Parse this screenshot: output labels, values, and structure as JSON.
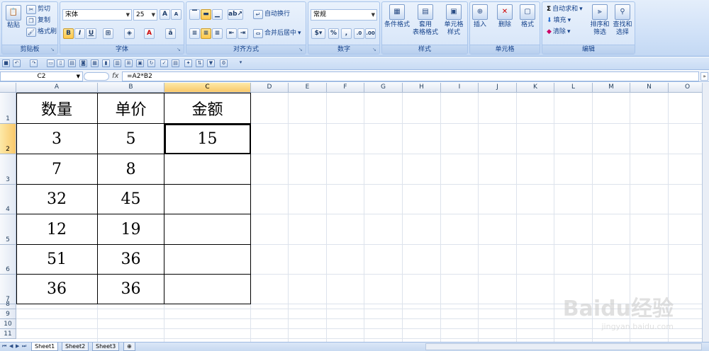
{
  "ribbon": {
    "clipboard": {
      "paste": "粘贴",
      "cut": "剪切",
      "copy": "复制",
      "format_painter": "格式刷",
      "label": "剪贴板"
    },
    "font": {
      "font_name": "宋体",
      "font_size": "25",
      "bold": "B",
      "italic": "I",
      "underline": "U",
      "label": "字体"
    },
    "alignment": {
      "wrap_text": "自动换行",
      "merge_center": "合并后居中",
      "label": "对齐方式"
    },
    "number": {
      "format": "常规",
      "percent": "%",
      "comma": ",",
      "label": "数字"
    },
    "styles": {
      "conditional": "条件格式",
      "table_line1": "套用",
      "table_line2": "表格格式",
      "cell_line1": "单元格",
      "cell_line2": "样式",
      "label": "样式"
    },
    "cells": {
      "insert": "插入",
      "delete": "删除",
      "format": "格式",
      "label": "单元格"
    },
    "editing": {
      "autosum": "自动求和",
      "fill": "填充",
      "clear": "清除",
      "sort_line1": "排序和",
      "sort_line2": "筛选",
      "find_line1": "查找和",
      "find_line2": "选择",
      "label": "编辑"
    }
  },
  "formula_bar": {
    "name_box": "C2",
    "fx": "fx",
    "formula": "=A2*B2"
  },
  "columns": [
    "A",
    "B",
    "C",
    "D",
    "E",
    "F",
    "G",
    "H",
    "I",
    "J",
    "K",
    "L",
    "M",
    "N",
    "O"
  ],
  "rows": [
    "1",
    "2",
    "3",
    "4",
    "5",
    "6",
    "7",
    "8",
    "9",
    "10",
    "11"
  ],
  "table": {
    "headers": [
      "数量",
      "单价",
      "金额"
    ],
    "rows": [
      [
        "3",
        "5",
        "15"
      ],
      [
        "7",
        "8",
        ""
      ],
      [
        "32",
        "45",
        ""
      ],
      [
        "12",
        "19",
        ""
      ],
      [
        "51",
        "36",
        ""
      ],
      [
        "36",
        "36",
        ""
      ]
    ]
  },
  "sheets": [
    "Sheet1",
    "Sheet2",
    "Sheet3"
  ],
  "watermark": {
    "main": "Baidu经验",
    "sub": "jingyan.baidu.com"
  },
  "colors": {
    "ribbon": "#dbe8f9",
    "selected_header": "#f9c86a",
    "grid_line": "#dde3ec"
  }
}
